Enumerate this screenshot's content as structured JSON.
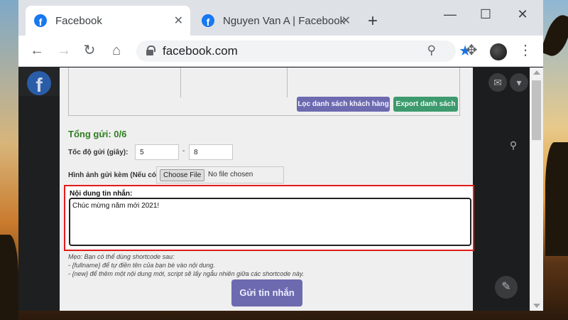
{
  "browser": {
    "tabs": [
      {
        "title": "Facebook",
        "active": true
      },
      {
        "title": "Nguyen Van A | Facebook",
        "active": false
      }
    ],
    "new_tab_glyph": "+",
    "window_controls": {
      "minimize": "—",
      "maximize": "☐",
      "close": "✕"
    },
    "nav": {
      "back": "←",
      "forward": "→",
      "reload": "↻",
      "home": "⌂"
    },
    "address": "facebook.com",
    "icons": {
      "zoom": "zoom-icon",
      "star": "bookmark-star-icon",
      "extensions": "puzzle-icon",
      "menu": "kebab-menu-icon"
    },
    "accent_color": "#1a73e8"
  },
  "facebook": {
    "logo_letter": "f"
  },
  "panel": {
    "filter_button": "Lọc danh sách khách hàng",
    "export_button": "Export danh sách",
    "total_label": "Tổng gửi: 0/6",
    "speed_label": "Tốc độ gửi (giây):",
    "speed_min": "5",
    "speed_max": "8",
    "speed_separator": "-",
    "attach_label": "Hình ảnh gửi kèm (Nếu có):",
    "choose_file_button": "Choose File",
    "file_status": "No file chosen",
    "message_label": "Nội dung tin nhắn:",
    "message_value": "Chúc mừng năm mới 2021!",
    "hints": [
      "Mẹo: Bạn có thể dùng shortcode sau:",
      "- {fullname} để tự điền tên của bạn bè vào nội dung.",
      "- {new} để thêm một nội dung mới, script sẽ lấy ngẫu nhiên giữa các shortcode này."
    ],
    "send_button": "Gửi tin nhắn",
    "colors": {
      "primary_button": "#6d6ab0",
      "export_button": "#3d9a6e",
      "total_text": "#2e7d20",
      "highlight_border": "#e31b1b"
    }
  }
}
